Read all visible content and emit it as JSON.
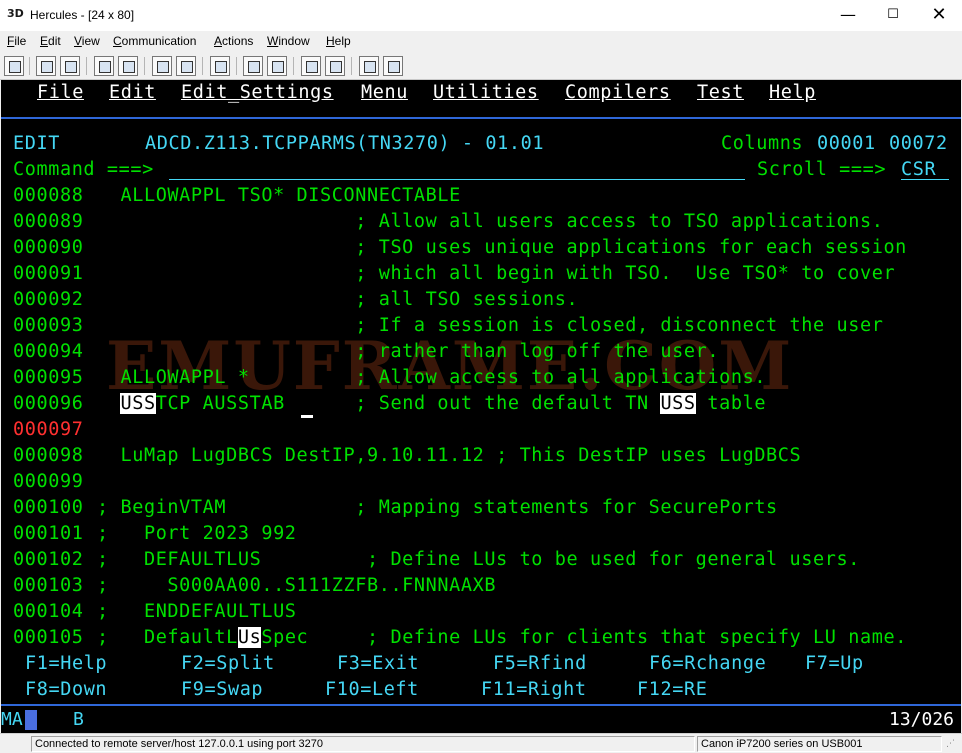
{
  "window": {
    "title": "Hercules - [24 x 80]",
    "app_icon": "3D",
    "minimize": "—",
    "maximize": "☐",
    "close": "✕"
  },
  "menubar": [
    "File",
    "Edit",
    "View",
    "Communication",
    "Actions",
    "Window",
    "Help"
  ],
  "toolbar_icons": [
    "print-icon",
    "copy-icon",
    "paste-icon",
    "send-icon",
    "receive-icon",
    "screen-icon",
    "screen2-icon",
    "keyboard-icon",
    "macro-icon",
    "macro2-icon",
    "record-icon",
    "play-icon",
    "globe-icon",
    "edit-icon"
  ],
  "ispf_menu": [
    "File",
    "Edit",
    "Edit_Settings",
    "Menu",
    "Utilities",
    "Compilers",
    "Test",
    "Help"
  ],
  "header": {
    "mode": "EDIT",
    "dataset": "ADCD.Z113.TCPPARMS(TN3270) - 01.01",
    "columns_label": "Columns",
    "col_start": "00001",
    "col_end": "00072",
    "command_label": "Command ===>",
    "command_value": "",
    "scroll_label": "Scroll ===>",
    "scroll_value": "CSR"
  },
  "lines": [
    {
      "num": "000088",
      "text": "  ALLOWAPPL TSO* DISCONNECTABLE"
    },
    {
      "num": "000089",
      "text": "                      ; Allow all users access to TSO applications."
    },
    {
      "num": "000090",
      "text": "                      ; TSO uses unique applications for each session"
    },
    {
      "num": "000091",
      "text": "                      ; which all begin with TSO.  Use TSO* to cover"
    },
    {
      "num": "000092",
      "text": "                      ; all TSO sessions."
    },
    {
      "num": "000093",
      "text": "                      ; If a session is closed, disconnect the user"
    },
    {
      "num": "000094",
      "text": "                      ; rather than log off the user."
    },
    {
      "num": "000095",
      "text": "  ALLOWAPPL *         ; Allow access to all applications."
    },
    {
      "num": "000096",
      "pre": "  ",
      "hl1": "USS",
      "mid": "TCP AUSSTAB  ",
      "mid2": "    ; Send out the default TN ",
      "hl2": "USS",
      "post": " table"
    },
    {
      "num": "000097",
      "text": ""
    },
    {
      "num": "000098",
      "text": "  LuMap LugDBCS DestIP,9.10.11.12 ; This DestIP uses LugDBCS"
    },
    {
      "num": "000099",
      "text": ""
    },
    {
      "num": "000100",
      "text": "; BeginVTAM           ; Mapping statements for SecurePorts"
    },
    {
      "num": "000101",
      "text": ";   Port 2023 992"
    },
    {
      "num": "000102",
      "text": ";   DEFAULTLUS         ; Define LUs to be used for general users."
    },
    {
      "num": "000103",
      "text": ";     S000AA00..S111ZZFB..FNNNAAXB"
    },
    {
      "num": "000104",
      "text": ";   ENDDEFAULTLUS"
    },
    {
      "num": "000105",
      "pre": ";   DefaultL",
      "hl1": "Us",
      "mid": "Spec     ; Define LUs for clients that specify LU name."
    }
  ],
  "pf_keys_row1": [
    "F1=Help",
    "F2=Split",
    "F3=Exit",
    "F5=Rfind",
    "F6=Rchange",
    "F7=Up"
  ],
  "pf_keys_row2": [
    "F8=Down",
    "F9=Swap",
    "F10=Left",
    "F11=Right",
    "F12=RE"
  ],
  "watermark": "EMUFRAME.COM",
  "oia": {
    "ma": "MA",
    "mode": "B",
    "position": "13/026"
  },
  "status": {
    "connection": "Connected to remote server/host 127.0.0.1 using port 3270",
    "printer": "Canon iP7200 series on USB001"
  },
  "colors": {
    "green": "#00e000",
    "cyan": "#45d7f4",
    "white": "#ffffff",
    "red": "#ff3030",
    "accent": "#2f67d8"
  }
}
